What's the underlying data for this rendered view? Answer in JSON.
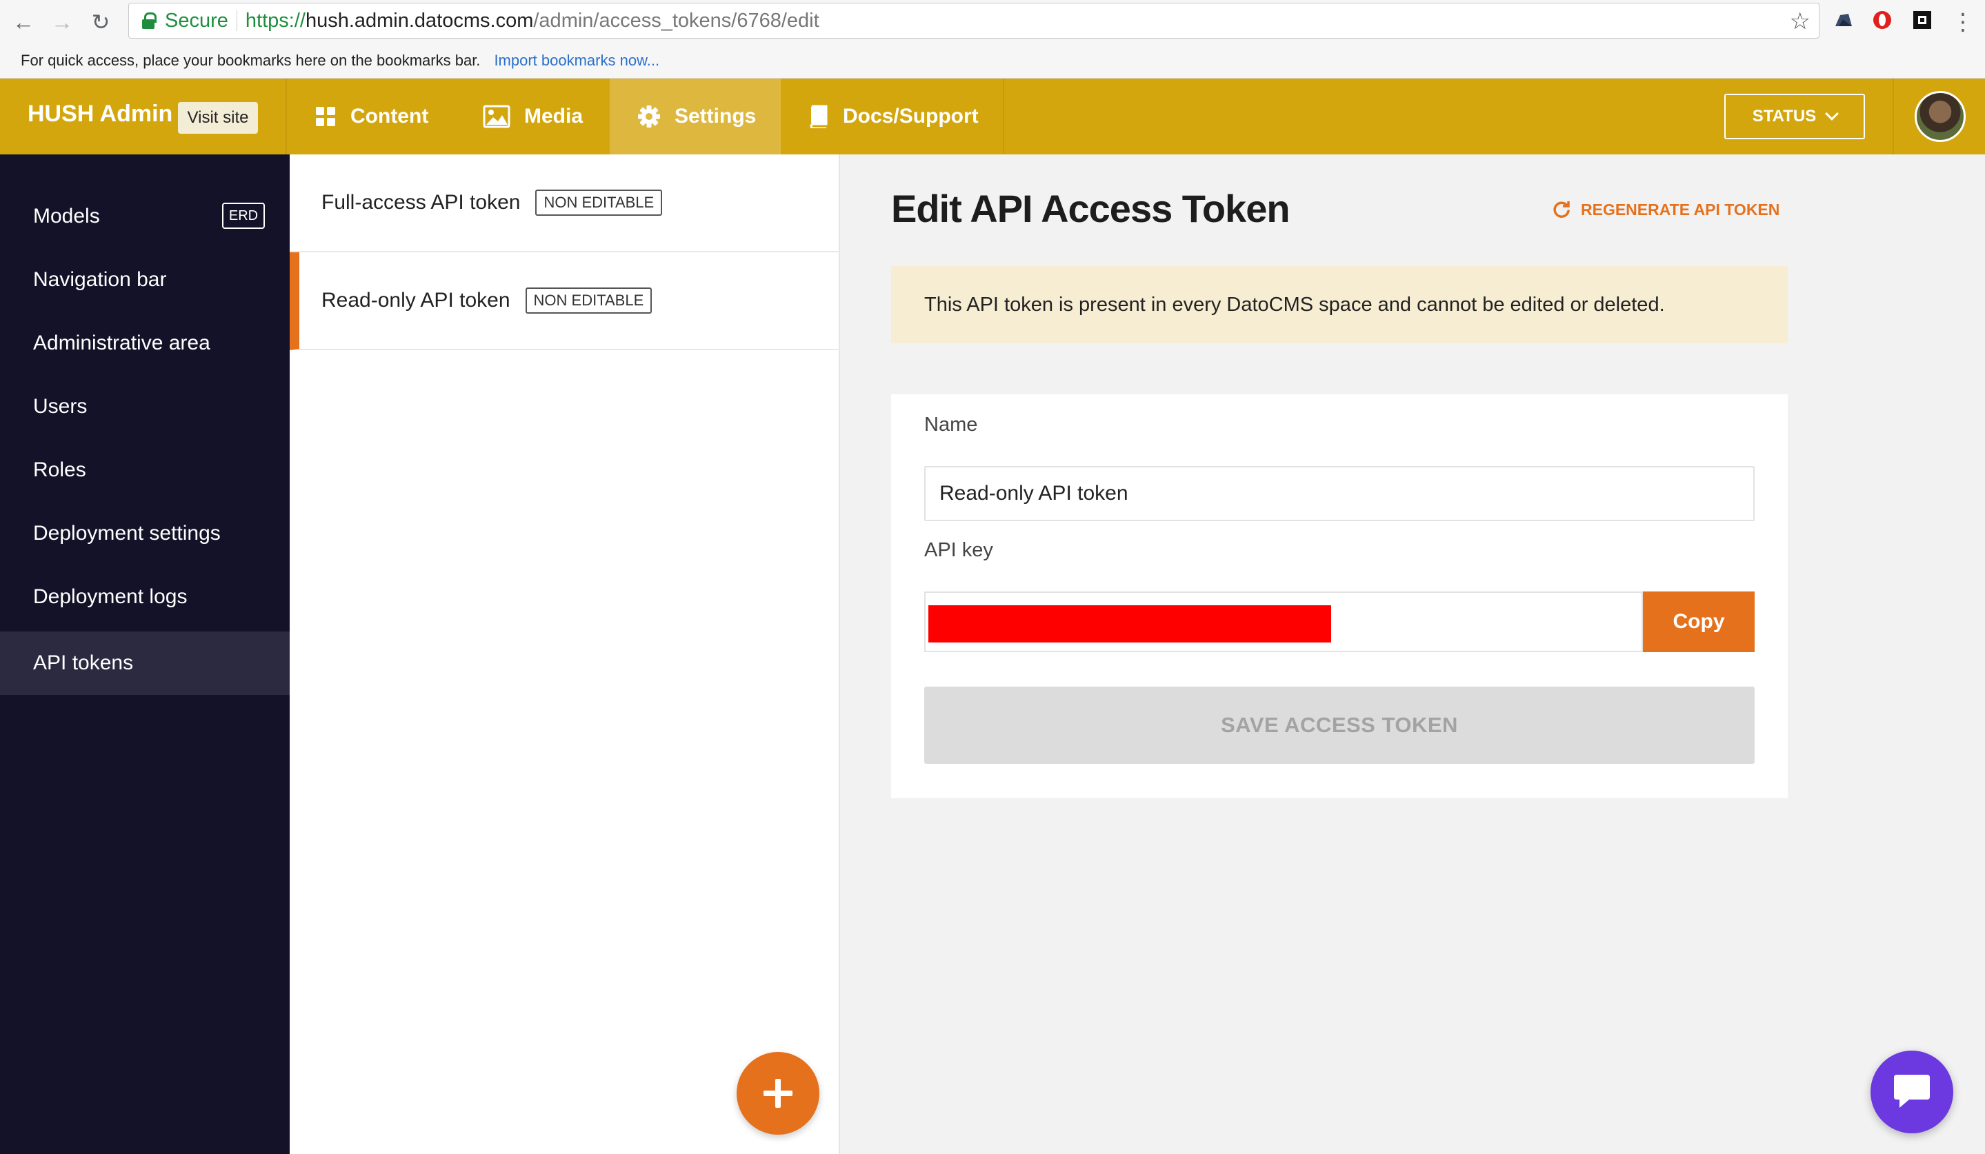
{
  "browser": {
    "secure_label": "Secure",
    "url_scheme": "https://",
    "url_host": "hush.admin.datocms.com",
    "url_path": "/admin/access_tokens/6768/edit",
    "bookmarks_hint": "For quick access, place your bookmarks here on the bookmarks bar.",
    "import_bookmarks": "Import bookmarks now..."
  },
  "topbar": {
    "brand": "HUSH Admin",
    "visit_site": "Visit site",
    "tabs": [
      {
        "label": "Content",
        "icon": "dashboard-icon"
      },
      {
        "label": "Media",
        "icon": "image-icon"
      },
      {
        "label": "Settings",
        "icon": "gear-icon",
        "active": true
      },
      {
        "label": "Docs/Support",
        "icon": "book-icon"
      }
    ],
    "status_button": "STATUS"
  },
  "sidebar": {
    "items": [
      {
        "label": "Models",
        "badge": "ERD"
      },
      {
        "label": "Navigation bar"
      },
      {
        "label": "Administrative area"
      },
      {
        "label": "Users"
      },
      {
        "label": "Roles"
      },
      {
        "label": "Deployment settings"
      },
      {
        "label": "Deployment logs"
      },
      {
        "label": "API tokens",
        "active": true
      }
    ]
  },
  "token_list": {
    "items": [
      {
        "name": "Full-access API token",
        "badge": "NON EDITABLE"
      },
      {
        "name": "Read-only API token",
        "badge": "NON EDITABLE",
        "active": true
      }
    ]
  },
  "main": {
    "title": "Edit API Access Token",
    "regenerate": "REGENERATE API TOKEN",
    "notice": "This API token is present in every DatoCMS space and cannot be edited or deleted.",
    "name_label": "Name",
    "name_value": "Read-only API token",
    "api_key_label": "API key",
    "copy_button": "Copy",
    "save_button": "SAVE ACCESS TOKEN"
  },
  "colors": {
    "topbar": "#d4a60e",
    "sidebar": "#141228",
    "accent": "#e5711d",
    "chat": "#6c38e0"
  }
}
